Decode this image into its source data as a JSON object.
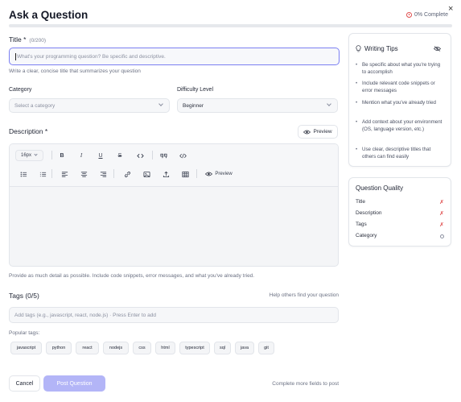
{
  "header": {
    "title": "Ask a Question",
    "progress_label": "0% Complete",
    "progress_value": 0,
    "close_glyph": "×"
  },
  "title_field": {
    "label": "Title *",
    "counter": "(0/200)",
    "placeholder": "What's your programming question? Be specific and descriptive.",
    "value": "",
    "hint": "Write a clear, concise title that summarizes your question"
  },
  "category": {
    "label": "Category",
    "selected": "Select a category"
  },
  "difficulty": {
    "label": "Difficulty Level",
    "selected": "Beginner"
  },
  "description": {
    "label": "Description *",
    "preview_label": "Preview",
    "toolbar": {
      "font_size": "16px",
      "preview_label": "Preview"
    },
    "hint": "Provide as much detail as possible. Include code snippets, error messages, and what you've already tried."
  },
  "tags": {
    "label": "Tags (0/5)",
    "helper": "Help others find your question",
    "placeholder": "Add tags (e.g., javascript, react, node.js) · Press Enter to add",
    "popular_label": "Popular tags:",
    "popular": [
      "javascript",
      "python",
      "react",
      "nodejs",
      "css",
      "html",
      "typescript",
      "sql",
      "java",
      "git"
    ]
  },
  "footer": {
    "cancel_label": "Cancel",
    "post_label": "Post Question",
    "status": "Complete more fields to post"
  },
  "writing_tips": {
    "title": "Writing Tips",
    "tips": [
      "Be specific about what you're trying to accomplish",
      "Include relevant code snippets or error messages",
      "Mention what you've already tried",
      "Add context about your environment (OS, language version, etc.)",
      "Use clear, descriptive titles that others can find easily"
    ]
  },
  "question_quality": {
    "title": "Question Quality",
    "items": [
      {
        "label": "Title",
        "status": "✗"
      },
      {
        "label": "Description",
        "status": "✗"
      },
      {
        "label": "Tags",
        "status": "✗"
      },
      {
        "label": "Category",
        "status": ""
      }
    ]
  },
  "colors": {
    "accent": "#7b7ff2",
    "accent_disabled": "#b3b5f7",
    "error": "#e04e4e"
  }
}
